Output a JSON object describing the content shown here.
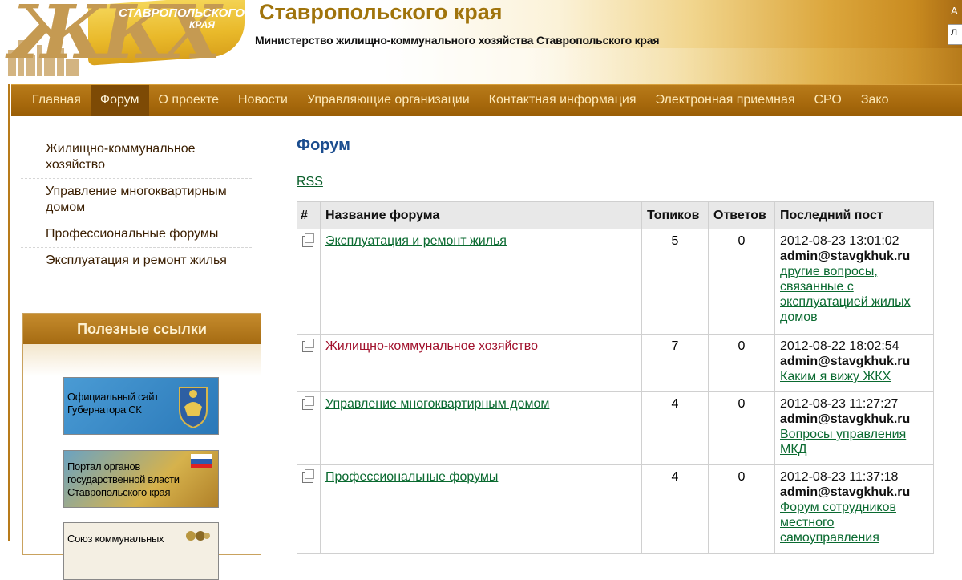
{
  "header": {
    "logo_letters": "ЖКХ",
    "logo_line1": "СТАВРОПОЛЬСКОГО",
    "logo_line2": "КРАЯ",
    "title": "Ставропольского края",
    "subtitle": "Министерство жилищно-коммунального хозяйства Ставропольского края",
    "corner_text": "А",
    "corner_input_value": "л"
  },
  "nav": {
    "items": [
      {
        "label": "Главная"
      },
      {
        "label": "Форум"
      },
      {
        "label": "О проекте"
      },
      {
        "label": "Новости"
      },
      {
        "label": "Управляющие организации"
      },
      {
        "label": "Контактная информация"
      },
      {
        "label": "Электронная приемная"
      },
      {
        "label": "СРО"
      },
      {
        "label": "Зако"
      }
    ],
    "active_index": 1
  },
  "sidebar": {
    "items": [
      {
        "label": "Жилищно-коммунальное хозяйство"
      },
      {
        "label": "Управление многоквартирным домом"
      },
      {
        "label": "Профессиональные форумы"
      },
      {
        "label": "Эксплуатация и ремонт жилья"
      }
    ],
    "links_title": "Полезные ссылки",
    "banners": [
      {
        "text": "Официальный сайт Губернатора СК"
      },
      {
        "text": "Портал органов государственной власти Ставропольского края"
      },
      {
        "text": "Союз коммунальных"
      }
    ]
  },
  "main": {
    "title": "Форум",
    "rss_label": "RSS",
    "columns": [
      "#",
      "Название форума",
      "Топиков",
      "Ответов",
      "Последний пост"
    ],
    "rows": [
      {
        "name": "Эксплуатация и ремонт жилья",
        "topics": "5",
        "replies": "0",
        "date": "2012-08-23 13:01:02",
        "user": "admin@stavgkhuk.ru",
        "topic": "другие вопросы, связанные с эксплуатацией жилых домов",
        "visited": false
      },
      {
        "name": "Жилищно-коммунальное хозяйство",
        "topics": "7",
        "replies": "0",
        "date": "2012-08-22 18:02:54",
        "user": "admin@stavgkhuk.ru",
        "topic": "Каким я вижу ЖКХ",
        "visited": true
      },
      {
        "name": "Управление многоквартирным домом",
        "topics": "4",
        "replies": "0",
        "date": "2012-08-23 11:27:27",
        "user": "admin@stavgkhuk.ru",
        "topic": "Вопросы управления МКД",
        "visited": false
      },
      {
        "name": "Профессиональные форумы",
        "topics": "4",
        "replies": "0",
        "date": "2012-08-23 11:37:18",
        "user": "admin@stavgkhuk.ru",
        "topic": "Форум сотрудников местного самоуправления",
        "visited": false
      }
    ]
  },
  "colors": {
    "nav_bg": "#a96b0e",
    "nav_active": "#7d4a05",
    "link_green": "#0a6a30",
    "link_visited": "#a1112c",
    "title_blue": "#1b4d8f"
  }
}
